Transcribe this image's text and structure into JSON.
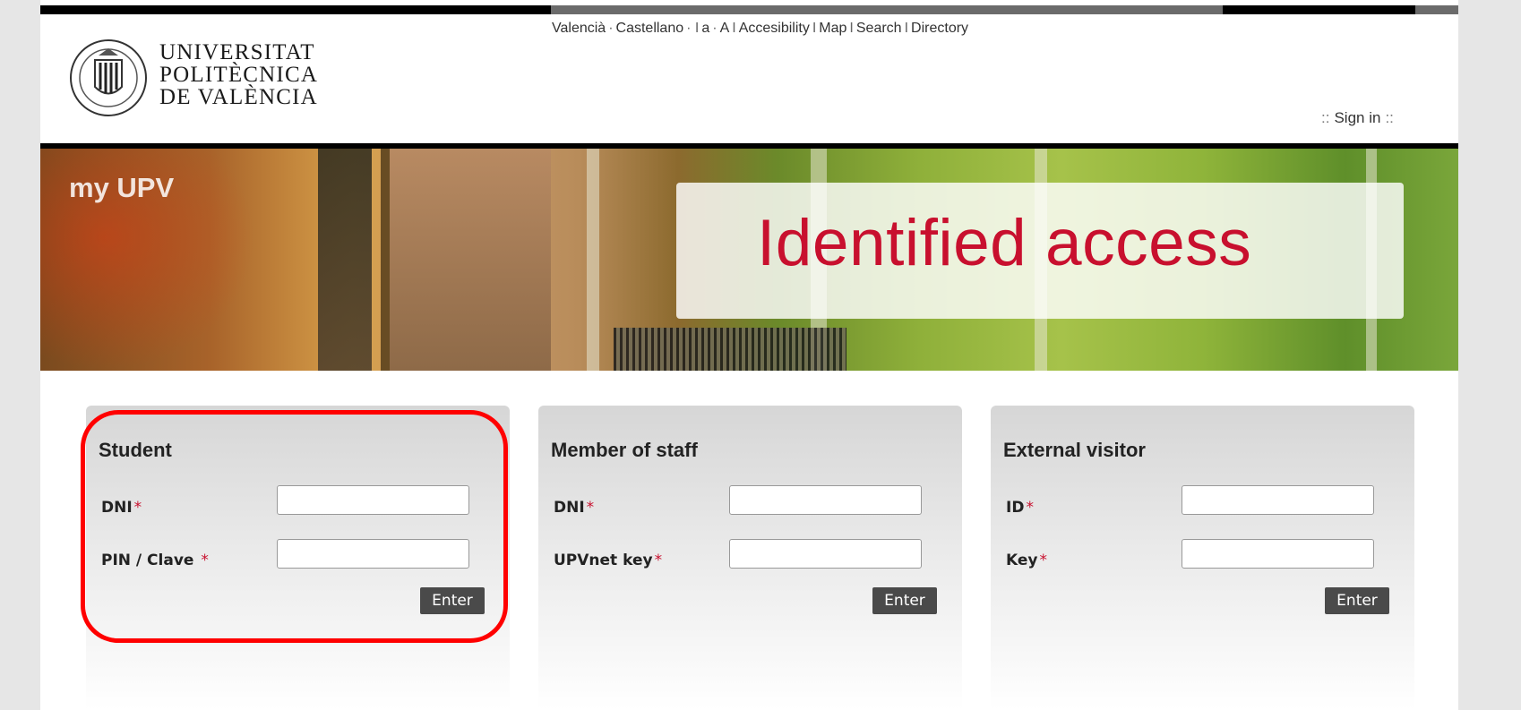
{
  "header": {
    "logo": {
      "line1": "UNIVERSITAT",
      "line2": "POLITÈCNICA",
      "line3": "DE  VALÈNCIA",
      "seal_text": "UNIVERSITAT POLITÈCNICA DE VALÈNCIA"
    },
    "toplinks": {
      "valencia": "Valencià",
      "castellano": "Castellano",
      "font_small": "a",
      "font_large": "A",
      "accessibility": "Accesibility",
      "map": "Map",
      "search": "Search",
      "directory": "Directory"
    },
    "signin": {
      "prefix": "::",
      "label": "Sign in",
      "suffix": "::"
    }
  },
  "banner": {
    "brand": "my UPV",
    "title": "Identified access"
  },
  "panels": [
    {
      "title": "Student",
      "field1_label": "DNI",
      "field1_value": "",
      "field2_label": "PIN / Clave ",
      "field2_value": "",
      "required_mark": "*",
      "button": "Enter"
    },
    {
      "title": "Member of staff",
      "field1_label": "DNI",
      "field1_value": "",
      "field2_label": "UPVnet key",
      "field2_value": "",
      "required_mark": "*",
      "button": "Enter"
    },
    {
      "title": "External visitor",
      "field1_label": "ID",
      "field1_value": "",
      "field2_label": "Key",
      "field2_value": "",
      "required_mark": "*",
      "button": "Enter"
    }
  ],
  "colors": {
    "brand_red": "#c8102e",
    "highlight_red": "#ff0000",
    "button_bg": "#4a4a4a"
  }
}
